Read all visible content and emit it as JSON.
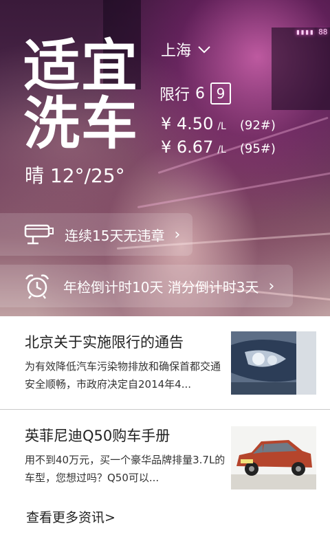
{
  "hero": {
    "title_line1": "适宜",
    "title_line2": "洗车",
    "weather": "晴 12°/25°",
    "city": "上海",
    "limit_label": "限行",
    "limit_num1": "6",
    "limit_num2": "9",
    "prices": [
      {
        "amount": "¥ 4.50",
        "unit": "/L",
        "grade": "(92#)"
      },
      {
        "amount": "¥ 6.67",
        "unit": "/L",
        "grade": "(95#)"
      }
    ],
    "violation_text": "连续15天无违章",
    "countdown_text": "年检倒计时10天  消分倒计时3天"
  },
  "news": [
    {
      "title": "北京关于实施限行的通告",
      "desc": "为有效降低汽车污染物排放和确保首都交通安全顺畅，市政府决定自2014年4...",
      "thumb_icon": "car-headlight-photo"
    },
    {
      "title": "英菲尼迪Q50购车手册",
      "desc": "用不到40万元，买一个豪华品牌排量3.7L的车型，您想过吗？Q50可以...",
      "thumb_icon": "red-car-photo"
    }
  ],
  "more_link": "查看更多资讯>"
}
